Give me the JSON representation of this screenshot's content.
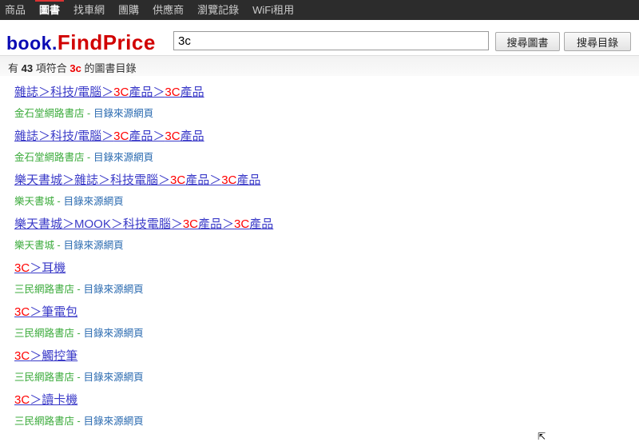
{
  "nav": {
    "tabs": [
      "商品",
      "圖書",
      "找車網",
      "團購",
      "供應商",
      "瀏覽記錄",
      "WiFi租用"
    ],
    "active": 1
  },
  "logo": {
    "part1": "book.",
    "part2": "FindPrice"
  },
  "search": {
    "value": "3c",
    "btn_books": "搜尋圖書",
    "btn_catalog": "搜尋目錄"
  },
  "status": {
    "prefix": "有",
    "count": "43",
    "mid": "項符合",
    "keyword": "3c",
    "suffix": "的圖書目錄"
  },
  "results": [
    {
      "title": [
        [
          "雜誌＞科技/電腦＞",
          0
        ],
        [
          "3C",
          1
        ],
        [
          "產品＞",
          0
        ],
        [
          "3C",
          1
        ],
        [
          "產品",
          0
        ]
      ],
      "store": "金石堂網路書店",
      "sep": "-",
      "link": "目錄來源網頁"
    },
    {
      "title": [
        [
          "雜誌＞科技/電腦＞",
          0
        ],
        [
          "3C",
          1
        ],
        [
          "產品＞",
          0
        ],
        [
          "3C",
          1
        ],
        [
          "產品",
          0
        ]
      ],
      "store": "金石堂網路書店",
      "sep": "-",
      "link": "目錄來源網頁"
    },
    {
      "title": [
        [
          "樂天書城＞雜誌＞科技電腦＞",
          0
        ],
        [
          "3C",
          1
        ],
        [
          "產品＞",
          0
        ],
        [
          "3C",
          1
        ],
        [
          "產品",
          0
        ]
      ],
      "store": "樂天書城",
      "sep": "-",
      "link": "目錄來源網頁"
    },
    {
      "title": [
        [
          "樂天書城＞MOOK＞科技電腦＞",
          0
        ],
        [
          "3C",
          1
        ],
        [
          "產品＞",
          0
        ],
        [
          "3C",
          1
        ],
        [
          "產品",
          0
        ]
      ],
      "store": "樂天書城",
      "sep": "-",
      "link": "目錄來源網頁"
    },
    {
      "title": [
        [
          "3C",
          1
        ],
        [
          "＞耳機",
          0
        ]
      ],
      "store": "三民網路書店",
      "sep": "-",
      "link": "目錄來源網頁"
    },
    {
      "title": [
        [
          "3C",
          1
        ],
        [
          "＞筆電包",
          0
        ]
      ],
      "store": "三民網路書店",
      "sep": "-",
      "link": "目錄來源網頁"
    },
    {
      "title": [
        [
          "3C",
          1
        ],
        [
          "＞觸控筆",
          0
        ]
      ],
      "store": "三民網路書店",
      "sep": "-",
      "link": "目錄來源網頁"
    },
    {
      "title": [
        [
          "3C",
          1
        ],
        [
          "＞讀卡機",
          0
        ]
      ],
      "store": "三民網路書店",
      "sep": "-",
      "link": "目錄來源網頁"
    }
  ]
}
